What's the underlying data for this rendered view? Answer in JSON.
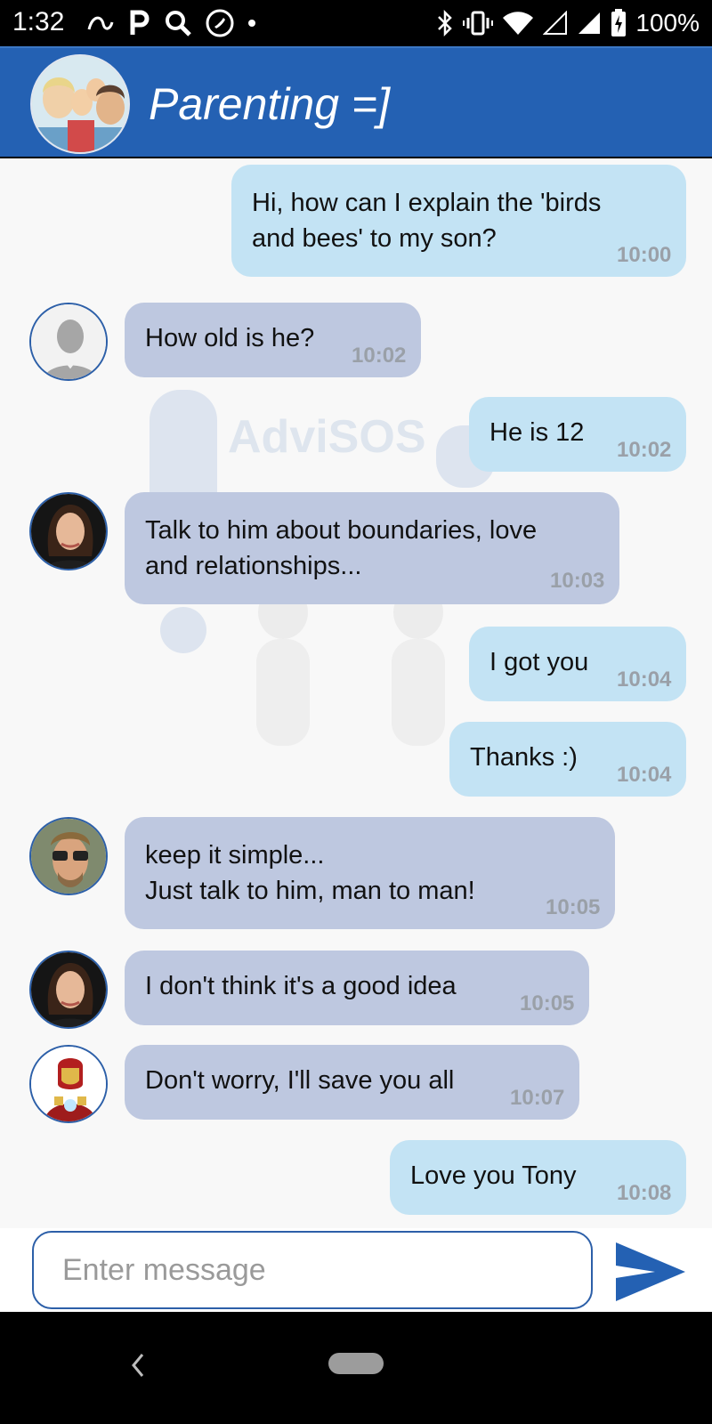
{
  "status_bar": {
    "time": "1:32",
    "battery": "100%",
    "icons": [
      "alexa-icon",
      "p-icon",
      "search-icon",
      "phone-icon",
      "dot-icon",
      "bluetooth-icon",
      "vibrate-icon",
      "wifi-icon",
      "signal-icon",
      "signal-icon",
      "battery-charging-icon"
    ]
  },
  "header": {
    "title": "Parenting =]",
    "accent_color": "#2461b3"
  },
  "watermark_text": "AdviSOS",
  "messages": [
    {
      "direction": "out",
      "text": "Hi, how can I explain the 'birds\nand bees' to my son?",
      "time": "10:00"
    },
    {
      "direction": "in",
      "avatar": "default-user-avatar",
      "text": "How old is he?",
      "time": "10:02"
    },
    {
      "direction": "out",
      "text": "He is 12",
      "time": "10:02"
    },
    {
      "direction": "in",
      "avatar": "woman-avatar",
      "text": "Talk to him about boundaries, love\nand relationships...",
      "time": "10:03"
    },
    {
      "direction": "out",
      "text": "I got you",
      "time": "10:04"
    },
    {
      "direction": "out",
      "text": "Thanks :)",
      "time": "10:04"
    },
    {
      "direction": "in",
      "avatar": "man-sunglasses-avatar",
      "text": "keep it simple...\nJust talk to him, man to man!",
      "time": "10:05"
    },
    {
      "direction": "in",
      "avatar": "woman-avatar",
      "text": "I don't think it's a good idea",
      "time": "10:05"
    },
    {
      "direction": "in",
      "avatar": "iron-suit-avatar",
      "text": "Don't worry, I'll save you all",
      "time": "10:07"
    },
    {
      "direction": "out",
      "text": "Love you Tony",
      "time": "10:08"
    }
  ],
  "composer": {
    "placeholder": "Enter message",
    "value": ""
  },
  "colors": {
    "outgoing_bubble": "#c3e3f4",
    "incoming_bubble": "#bec8e0",
    "send_icon": "#2461b3"
  }
}
